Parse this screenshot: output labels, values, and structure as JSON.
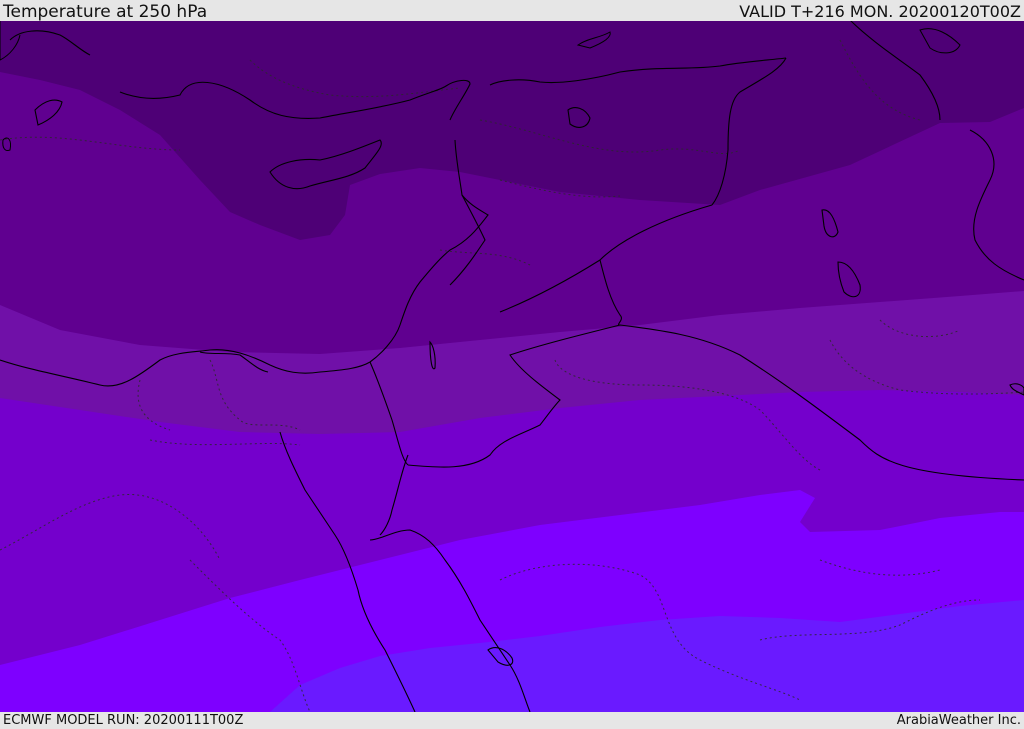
{
  "header": {
    "title": "Temperature at 250 hPa",
    "valid": "VALID T+216 MON. 20200120T00Z"
  },
  "footer": {
    "model_run": "ECMWF MODEL RUN: 20200111T00Z",
    "credit": "ArabiaWeather Inc."
  },
  "colors": {
    "band_coldest": "#4e0076",
    "band_2": "#600090",
    "band_3": "#7010a8",
    "band_4": "#7400cc",
    "band_5": "#7e00ff",
    "band_warmest": "#6a1aff",
    "coastline": "#000000",
    "border": "#2a2a2a"
  }
}
